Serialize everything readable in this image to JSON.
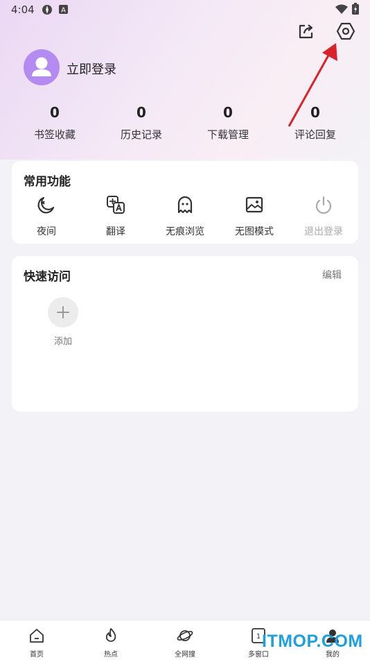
{
  "status_bar": {
    "time": "4:04"
  },
  "profile": {
    "login_label": "立即登录"
  },
  "stats": [
    {
      "value": "0",
      "label": "书签收藏"
    },
    {
      "value": "0",
      "label": "历史记录"
    },
    {
      "value": "0",
      "label": "下载管理"
    },
    {
      "value": "0",
      "label": "评论回复"
    }
  ],
  "common": {
    "title": "常用功能",
    "items": [
      {
        "label": "夜间",
        "icon": "night-mode-icon"
      },
      {
        "label": "翻译",
        "icon": "translate-icon"
      },
      {
        "label": "无痕浏览",
        "icon": "ghost-icon"
      },
      {
        "label": "无图模式",
        "icon": "no-image-icon"
      },
      {
        "label": "退出登录",
        "icon": "power-icon"
      }
    ]
  },
  "quick": {
    "title": "快速访问",
    "edit_label": "编辑",
    "add_label": "添加"
  },
  "nav": [
    {
      "label": "首页",
      "icon": "home-icon"
    },
    {
      "label": "热点",
      "icon": "flame-icon"
    },
    {
      "label": "全网搜",
      "icon": "planet-icon"
    },
    {
      "label": "多窗口",
      "icon": "window-icon"
    },
    {
      "label": "我的",
      "icon": "user-icon"
    }
  ],
  "watermark": "ITMOP.COM",
  "colors": {
    "avatar": "#b48cf1",
    "arrow": "#d9232a",
    "watermark": "#1fa0de"
  }
}
